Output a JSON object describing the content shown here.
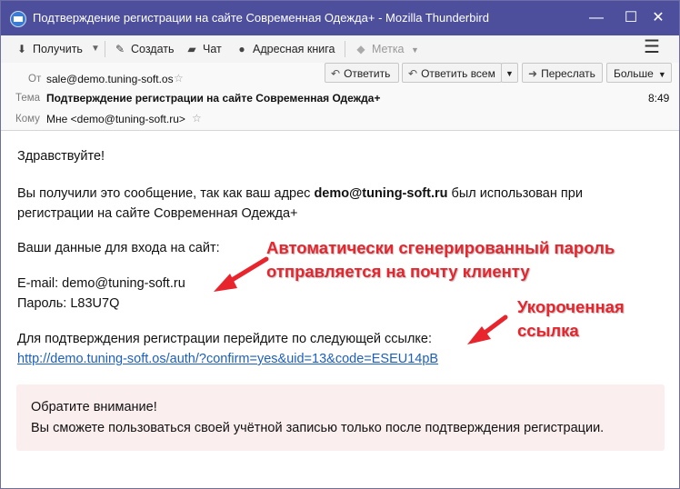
{
  "window": {
    "title": "Подтверждение регистрации на сайте Современная Одежда+ - Mozilla Thunderbird",
    "minimize": "—",
    "maximize": "☐",
    "close": "✕"
  },
  "toolbar": {
    "get": "Получить",
    "write": "Создать",
    "chat": "Чат",
    "address_book": "Адресная книга",
    "tag": "Метка",
    "menu": "☰"
  },
  "header": {
    "from_label": "От",
    "from_value": "sale@demo.tuning-soft.os",
    "subject_label": "Тема",
    "subject_value": "Подтверждение регистрации на сайте Современная Одежда+",
    "time": "8:49",
    "to_label": "Кому",
    "to_value": "Мне <demo@tuning-soft.ru>",
    "reply": "Ответить",
    "reply_all": "Ответить всем",
    "forward": "Переслать",
    "more": "Больше"
  },
  "message": {
    "greeting": "Здравствуйте!",
    "line1_a": "Вы получили это сообщение, так как ваш адрес ",
    "line1_email": "demo@tuning-soft.ru",
    "line1_b": " был использован при",
    "line2": "регистрации на сайте Современная Одежда+",
    "login_intro": "Ваши данные для входа на сайт:",
    "email_line": "E-mail: demo@tuning-soft.ru",
    "password_line": "Пароль: L83U7Q",
    "confirm_intro": "Для подтверждения регистрации перейдите по следующей ссылке:",
    "confirm_link": "http://demo.tuning-soft.os/auth/?confirm=yes&uid=13&code=ESEU14pB",
    "note_title": "Обратите внимание!",
    "note_text": "Вы сможете пользоваться своей учётной записью только после подтверждения регистрации."
  },
  "annotations": {
    "password_line1": "Автоматически сгенерированный пароль",
    "password_line2": "отправляется на почту клиенту",
    "link_line1": "Укороченная",
    "link_line2": "ссылка",
    "color": "#e8242d"
  }
}
